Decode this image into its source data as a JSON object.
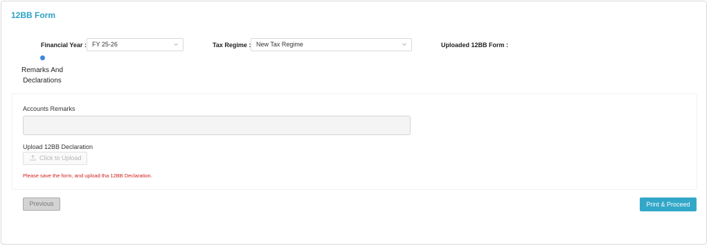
{
  "form": {
    "title": "12BB Form",
    "financial_year_label": "Financial Year :",
    "financial_year_value": "FY 25-26",
    "tax_regime_label": "Tax Regime :",
    "tax_regime_value": "New Tax Regime",
    "uploaded_label": "Uploaded 12BB Form :"
  },
  "steps": [
    {
      "label": "Remarks And Declarations",
      "active": true
    }
  ],
  "remarks": {
    "accounts_remarks_label": "Accounts Remarks",
    "accounts_remarks_value": "",
    "upload_label": "Upload 12BB Declaration",
    "upload_button": "Click to Upload",
    "upload_icon": "upload-icon",
    "error_text": "Please save the form, and upload tha 12BB Declaration."
  },
  "footer": {
    "previous_label": "Previous",
    "print_proceed_label": "Print & Proceed"
  },
  "colors": {
    "accent": "#2aa2c4",
    "primary_button": "#33a7c8",
    "step_dot": "#3b86e8",
    "error": "#d11d1d"
  }
}
